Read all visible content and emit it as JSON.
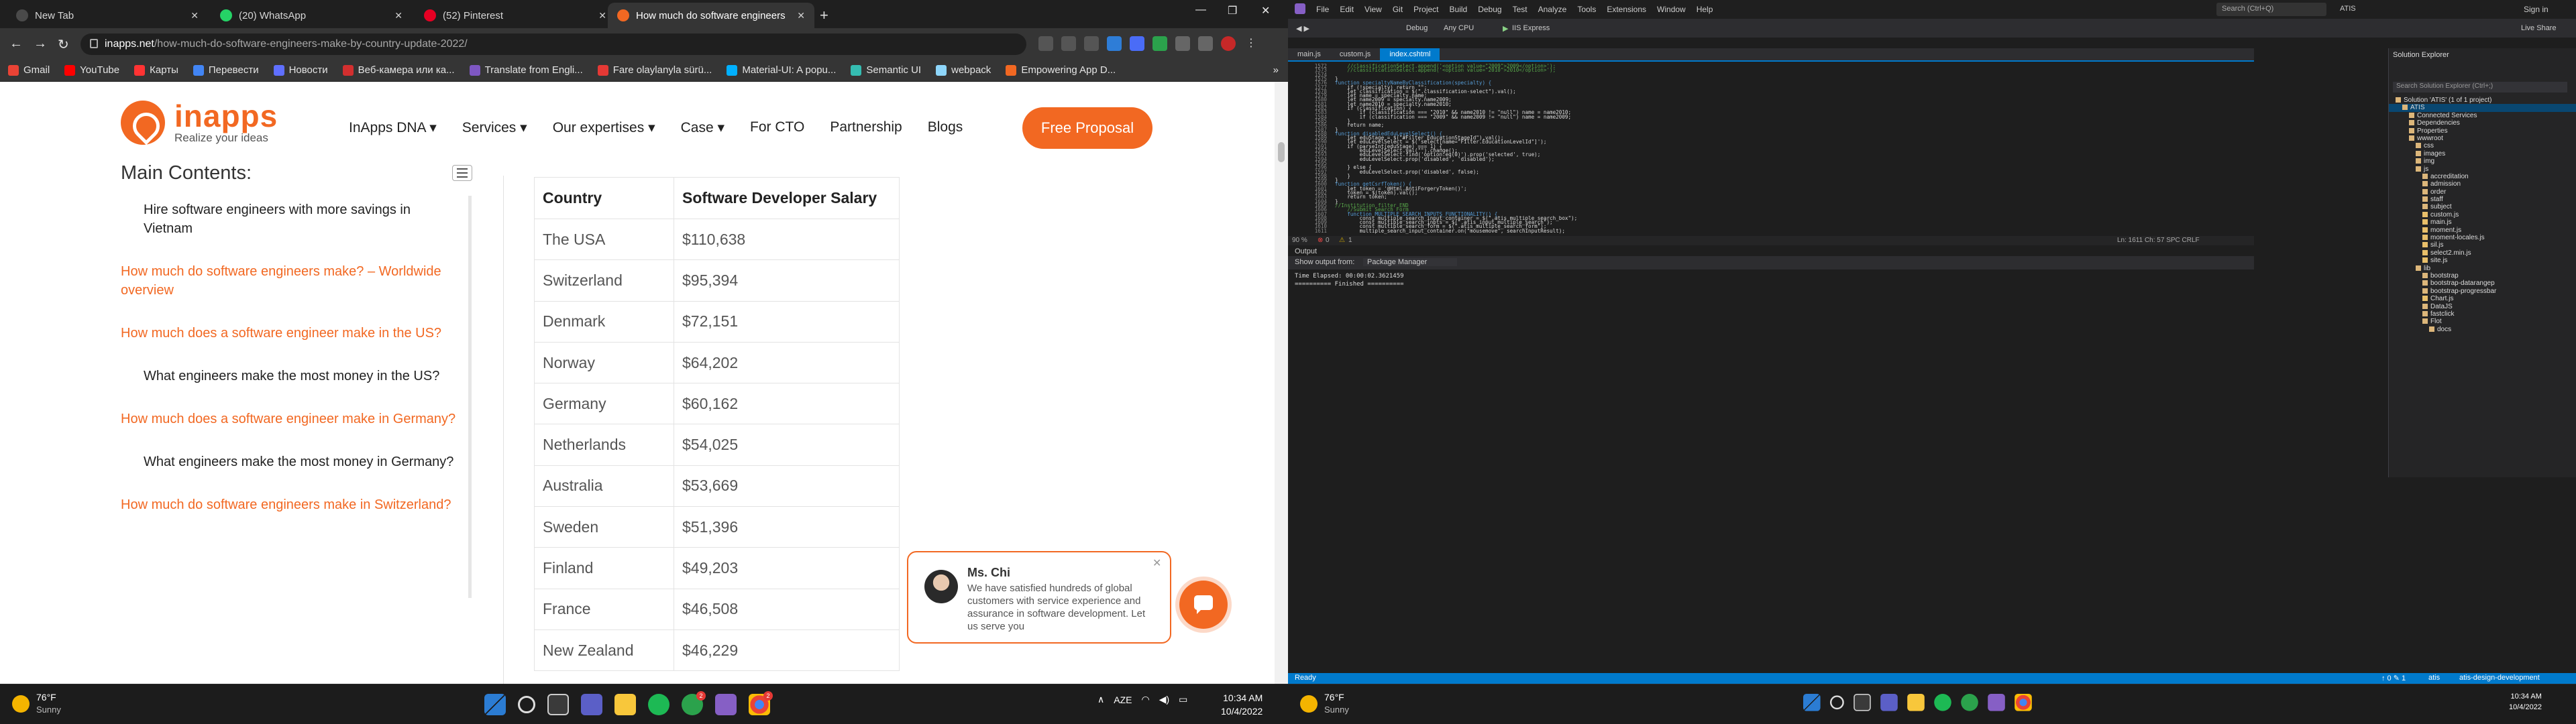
{
  "browser": {
    "tabs": [
      {
        "title": "New Tab",
        "color": "#4a4a4a"
      },
      {
        "title": "(20) WhatsApp",
        "color": "#25d366"
      },
      {
        "title": "(52) Pinterest",
        "color": "#e60023"
      },
      {
        "title": "How much do software engineers",
        "color": "#f26822"
      }
    ],
    "url_domain": "inapps.net",
    "url_path": "/how-much-do-software-engineers-make-by-country-update-2022/",
    "bookmarks": [
      {
        "label": "Gmail",
        "color": "#ea4335"
      },
      {
        "label": "YouTube",
        "color": "#ff0000"
      },
      {
        "label": "Карты",
        "color": "#ff3333"
      },
      {
        "label": "Перевести",
        "color": "#4285f4"
      },
      {
        "label": "Новости",
        "color": "#5f6fff"
      },
      {
        "label": "Веб-камера или ка...",
        "color": "#d32f2f"
      },
      {
        "label": "Translate from Engli...",
        "color": "#7e57c2"
      },
      {
        "label": "Fare olaylanyla sürü...",
        "color": "#e53935"
      },
      {
        "label": "Material-UI: A popu...",
        "color": "#00b0ff"
      },
      {
        "label": "Semantic UI",
        "color": "#35bdb2"
      },
      {
        "label": "webpack",
        "color": "#8ed6fb"
      },
      {
        "label": "Empowering App D...",
        "color": "#f26822"
      }
    ]
  },
  "site": {
    "logo_name": "inapps",
    "logo_tagline": "Realize your ideas",
    "nav": [
      "InApps DNA ▾",
      "Services ▾",
      "Our expertises ▾",
      "Case ▾",
      "For CTO",
      "Partnership",
      "Blogs"
    ],
    "cta": "Free Proposal",
    "toc_title": "Main Contents:",
    "toc": [
      {
        "text": "Hire software engineers with more savings in Vietnam",
        "kind": "sub"
      },
      {
        "text": "How much do software engineers make? – Worldwide overview",
        "kind": "main"
      },
      {
        "text": "How much does a software engineer make in the US?",
        "kind": "main"
      },
      {
        "text": "What engineers make the most money in the US?",
        "kind": "sub"
      },
      {
        "text": "How much does a software engineer make in Germany?",
        "kind": "main"
      },
      {
        "text": "What engineers make the most money in Germany?",
        "kind": "sub"
      },
      {
        "text": "How much do software engineers make in Switzerland?",
        "kind": "main"
      }
    ],
    "table": {
      "headers": [
        "Country",
        "Software Developer Salary"
      ],
      "rows": [
        [
          "The USA",
          "$110,638"
        ],
        [
          "Switzerland",
          "$95,394"
        ],
        [
          "Denmark",
          "$72,151"
        ],
        [
          "Norway",
          "$64,202"
        ],
        [
          "Germany",
          "$60,162"
        ],
        [
          "Netherlands",
          "$54,025"
        ],
        [
          "Australia",
          "$53,669"
        ],
        [
          "Sweden",
          "$51,396"
        ],
        [
          "Finland",
          "$49,203"
        ],
        [
          "France",
          "$46,508"
        ],
        [
          "New Zealand",
          "$46,229"
        ]
      ]
    },
    "chat": {
      "name": "Ms. Chi",
      "message": "We have satisfied hundreds of global customers with service experience and assurance in software development. Let us serve you"
    }
  },
  "vs": {
    "menu": [
      "File",
      "Edit",
      "View",
      "Git",
      "Project",
      "Build",
      "Debug",
      "Test",
      "Analyze",
      "Tools",
      "Extensions",
      "Window",
      "Help"
    ],
    "search": "Search (Ctrl+Q)",
    "solution": "ATIS",
    "signin": "Sign in",
    "toolbar": {
      "config": "Debug",
      "platform": "Any CPU",
      "run": "IIS Express",
      "live_share": "Live Share"
    },
    "tabs": [
      "main.js",
      "custom.js",
      "index.cshtml"
    ],
    "code_lines": [
      {
        "n": "1572",
        "t": "    //classificationSelect.append('<option value=\"2009\">2009</option>');",
        "c": "cm"
      },
      {
        "n": "1573",
        "t": "    //classificationSelect.append('<option value=\"2010\">2010</option>');",
        "c": "cm"
      },
      {
        "n": "1574",
        "t": "",
        "c": ""
      },
      {
        "n": "1575",
        "t": "}",
        "c": ""
      },
      {
        "n": "1576",
        "t": "function specialtyNameByClassification(specialty) {",
        "c": "kw"
      },
      {
        "n": "1577",
        "t": "    if (!specialty) return \"\";",
        "c": ""
      },
      {
        "n": "1578",
        "t": "    let classification = $(\".classification-select\").val();",
        "c": ""
      },
      {
        "n": "1579",
        "t": "    let name = specialty.name;",
        "c": ""
      },
      {
        "n": "1580",
        "t": "    let name2009 = specialty.name2009;",
        "c": ""
      },
      {
        "n": "1581",
        "t": "    let name2010 = specialty.name2010;",
        "c": ""
      },
      {
        "n": "1582",
        "t": "    if (classification) {",
        "c": ""
      },
      {
        "n": "1583",
        "t": "        if (classification === \"2010\" && name2010 != \"null\") name = name2010;",
        "c": ""
      },
      {
        "n": "1584",
        "t": "        if (classification === \"2009\" && name2009 != \"null\") name = name2009;",
        "c": ""
      },
      {
        "n": "1585",
        "t": "    }",
        "c": ""
      },
      {
        "n": "1586",
        "t": "    return name;",
        "c": ""
      },
      {
        "n": "1587",
        "t": "}",
        "c": ""
      },
      {
        "n": "1588",
        "t": "function disabledEduLevelSelect() {",
        "c": "kw"
      },
      {
        "n": "1589",
        "t": "    let eduStage = $(\"#Filter_EducationStageId\").val();",
        "c": ""
      },
      {
        "n": "1590",
        "t": "    let eduLevelSelect = $('select[name=\"Filter.EducationLevelId\"]');",
        "c": ""
      },
      {
        "n": "1591",
        "t": "    if (parseInt(eduStage) === 1) {",
        "c": ""
      },
      {
        "n": "1592",
        "t": "        eduLevelSelect.val(\"\").change();",
        "c": ""
      },
      {
        "n": "1593",
        "t": "        eduLevelSelect.find('option:eq(0)').prop('selected', true);",
        "c": ""
      },
      {
        "n": "1594",
        "t": "        eduLevelSelect.prop('disabled', 'disabled');",
        "c": ""
      },
      {
        "n": "1595",
        "t": "",
        "c": ""
      },
      {
        "n": "1596",
        "t": "    } else {",
        "c": ""
      },
      {
        "n": "1597",
        "t": "        eduLevelSelect.prop('disabled', false);",
        "c": ""
      },
      {
        "n": "1598",
        "t": "    }",
        "c": ""
      },
      {
        "n": "1599",
        "t": "}",
        "c": ""
      },
      {
        "n": "1600",
        "t": "function getCsrfToken() {",
        "c": "kw"
      },
      {
        "n": "1601",
        "t": "    let token = '@Html.AntiForgeryToken()';",
        "c": ""
      },
      {
        "n": "1602",
        "t": "    token = $(token).val();",
        "c": ""
      },
      {
        "n": "1603",
        "t": "    return token;",
        "c": ""
      },
      {
        "n": "1604",
        "t": "}",
        "c": ""
      },
      {
        "n": "1605",
        "t": "//Institution filter END",
        "c": "cm"
      },
      {
        "n": "1606",
        "t": "    //Submit Search Form",
        "c": "cm"
      },
      {
        "n": "1607",
        "t": "    function MULTIPLE_SEARCH_INPUTS_FUNCTIONALITY() {",
        "c": "kw"
      },
      {
        "n": "1608",
        "t": "        const multiple_search_input_container = $(\".atis_multiple_search_box\");",
        "c": ""
      },
      {
        "n": "1609",
        "t": "        const multiple_search_inpts = $(\".atis_input_multiple_search\");",
        "c": ""
      },
      {
        "n": "1610",
        "t": "        const multiple_search_form = $(\".atis_multiple_search_form\");",
        "c": ""
      },
      {
        "n": "1611",
        "t": "        multiple_search_input_container.on(\"mousemove\", searchInputResult);",
        "c": ""
      }
    ],
    "editor_status": {
      "zoom": "90 %",
      "errors": "0",
      "warnings": "1",
      "pos": "Ln: 1611   Ch: 57   SPC   CRLF"
    },
    "output": {
      "title": "Output",
      "show_from_label": "Show output from:",
      "source": "Package Manager",
      "lines": [
        "Time Elapsed: 00:00:02.3621459",
        "========== Finished =========="
      ]
    },
    "solution_explorer": {
      "title": "Solution Explorer",
      "search": "Search Solution Explorer (Ctrl+;)",
      "items": [
        {
          "label": "Solution 'ATIS' (1 of 1 project)",
          "depth": 0
        },
        {
          "label": "ATIS",
          "depth": 1
        },
        {
          "label": "Connected Services",
          "depth": 2
        },
        {
          "label": "Dependencies",
          "depth": 2
        },
        {
          "label": "Properties",
          "depth": 2
        },
        {
          "label": "wwwroot",
          "depth": 2
        },
        {
          "label": "css",
          "depth": 3
        },
        {
          "label": "images",
          "depth": 3
        },
        {
          "label": "img",
          "depth": 3
        },
        {
          "label": "js",
          "depth": 3
        },
        {
          "label": "accreditation",
          "depth": 4
        },
        {
          "label": "admission",
          "depth": 4
        },
        {
          "label": "order",
          "depth": 4
        },
        {
          "label": "staff",
          "depth": 4
        },
        {
          "label": "subject",
          "depth": 4
        },
        {
          "label": "custom.js",
          "depth": 4
        },
        {
          "label": "main.js",
          "depth": 4
        },
        {
          "label": "moment.js",
          "depth": 4
        },
        {
          "label": "moment-locales.js",
          "depth": 4
        },
        {
          "label": "sil.js",
          "depth": 4
        },
        {
          "label": "select2.min.js",
          "depth": 4
        },
        {
          "label": "site.js",
          "depth": 4
        },
        {
          "label": "lib",
          "depth": 3
        },
        {
          "label": "bootstrap",
          "depth": 4
        },
        {
          "label": "bootstrap-datarangep",
          "depth": 4
        },
        {
          "label": "bootstrap-progressbar",
          "depth": 4
        },
        {
          "label": "Chart.js",
          "depth": 4
        },
        {
          "label": "DataJS",
          "depth": 4
        },
        {
          "label": "fastclick",
          "depth": 4
        },
        {
          "label": "Flot",
          "depth": 4
        },
        {
          "label": "docs",
          "depth": 5
        }
      ]
    },
    "status": {
      "ready": "Ready",
      "counts": "↑ 0   ✎ 1",
      "repo": "atis",
      "branch": "atis-design-development"
    }
  },
  "taskbar": {
    "weather_temp": "76°F",
    "weather_desc": "Sunny",
    "lang": "AZE",
    "time": "10:34 AM",
    "date": "10/4/2022"
  }
}
